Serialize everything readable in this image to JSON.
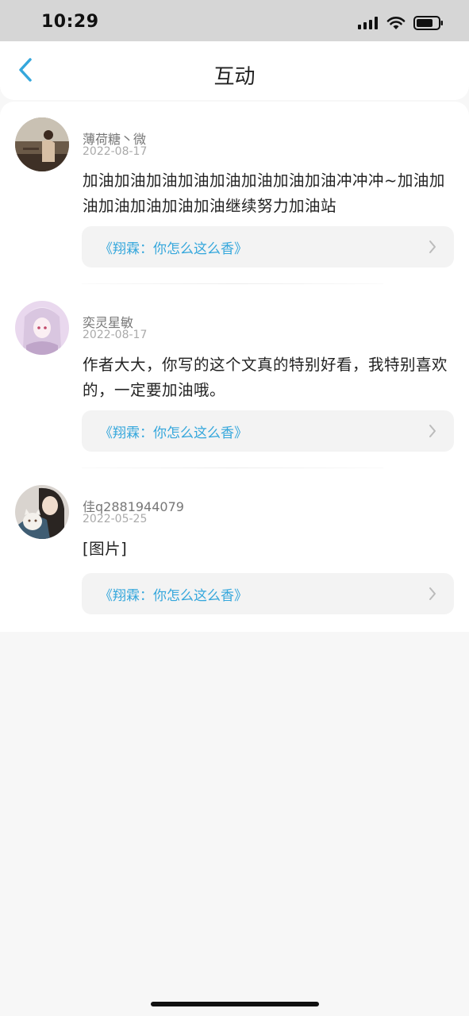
{
  "status_bar": {
    "time": "10:29"
  },
  "header": {
    "title": "互动",
    "back_icon": "chevron-left-icon",
    "accent_color": "#35a7dc"
  },
  "posts": [
    {
      "username": "薄荷糖丶微",
      "date": "2022-08-17",
      "message": "加油加油加油加油加油加油加油加油冲冲冲~加油加油加油加油加油加油继续努力加油站",
      "work_link": "《翔霖：你怎么这么香》"
    },
    {
      "username": "奕灵星敏",
      "date": "2022-08-17",
      "message": "作者大大，你写的这个文真的特别好看，我特别喜欢的，一定要加油哦。",
      "work_link": "《翔霖：你怎么这么香》"
    },
    {
      "username": "佳q2881944079",
      "date": "2022-05-25",
      "message": "[图片]",
      "work_link": "《翔霖：你怎么这么香》"
    }
  ]
}
